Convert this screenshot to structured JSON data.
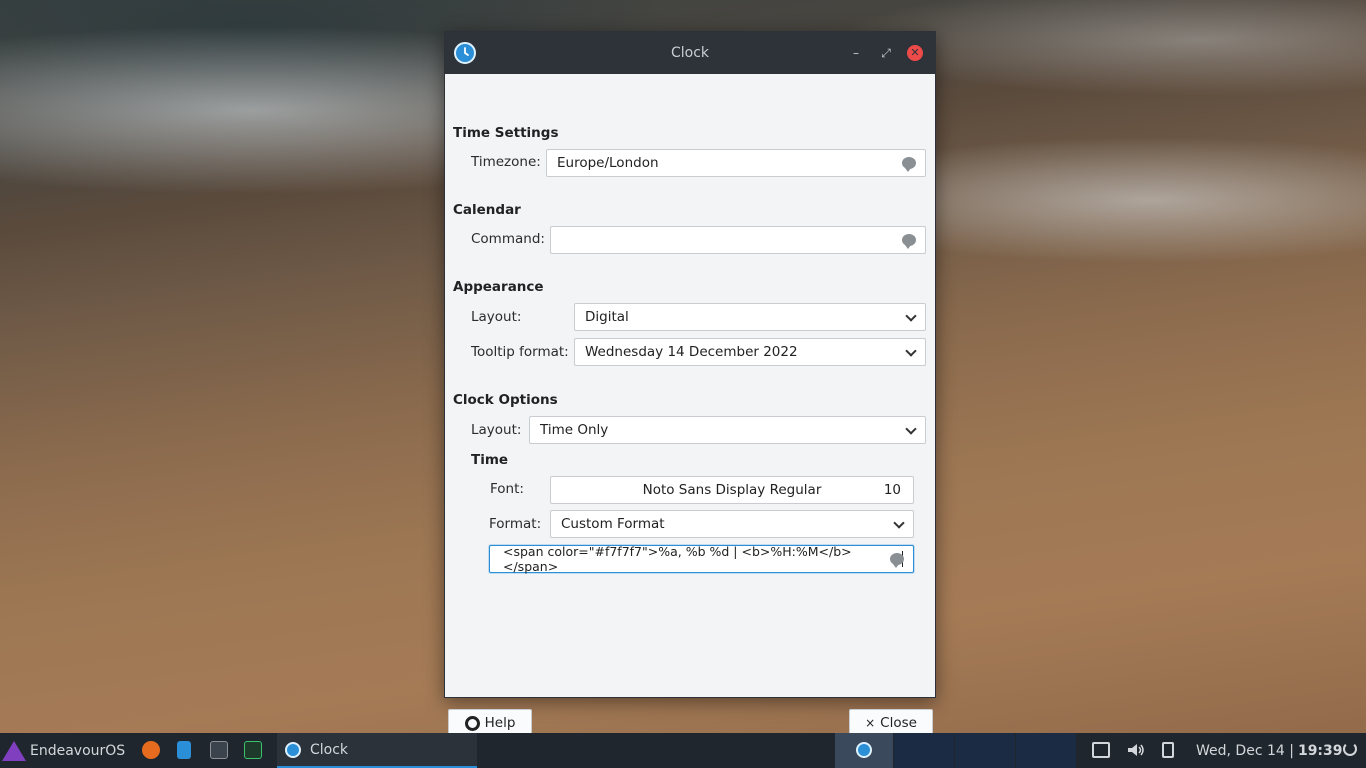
{
  "window": {
    "title": "Clock",
    "controls": {
      "minimize": "–",
      "maximize": "⤢",
      "close": "✕"
    }
  },
  "time_settings": {
    "heading": "Time Settings",
    "timezone_label": "Timezone:",
    "timezone_value": "Europe/London"
  },
  "calendar": {
    "heading": "Calendar",
    "command_label": "Command:",
    "command_value": ""
  },
  "appearance": {
    "heading": "Appearance",
    "layout_label": "Layout:",
    "layout_value": "Digital",
    "tooltip_label": "Tooltip format:",
    "tooltip_value": "Wednesday 14 December 2022"
  },
  "clock_options": {
    "heading": "Clock Options",
    "layout_label": "Layout:",
    "layout_value": "Time Only",
    "time_heading": "Time",
    "font_label": "Font:",
    "font_value": "Noto Sans Display Regular",
    "font_size": "10",
    "format_label": "Format:",
    "format_value": "Custom Format",
    "custom_format_value": "<span color=\"#f7f7f7\">%a, %b %d | <b>%H:%M</b></span>"
  },
  "buttons": {
    "help": "Help",
    "close": "Close"
  },
  "taskbar": {
    "start_label": "EndeavourOS",
    "task_label": "Clock",
    "clock_date": "Wed, Dec 14 |",
    "clock_time": "19:39",
    "icons": [
      "firefox-icon",
      "file-manager-icon",
      "terminal-icon",
      "system-monitor-icon",
      "display-icon",
      "volume-icon",
      "power-icon",
      "power-button-icon"
    ]
  },
  "colors": {
    "accent": "#2a8fd6",
    "titlebar": "#2e3339",
    "close_button": "#ed4a4a",
    "taskbar": "#20262d"
  }
}
